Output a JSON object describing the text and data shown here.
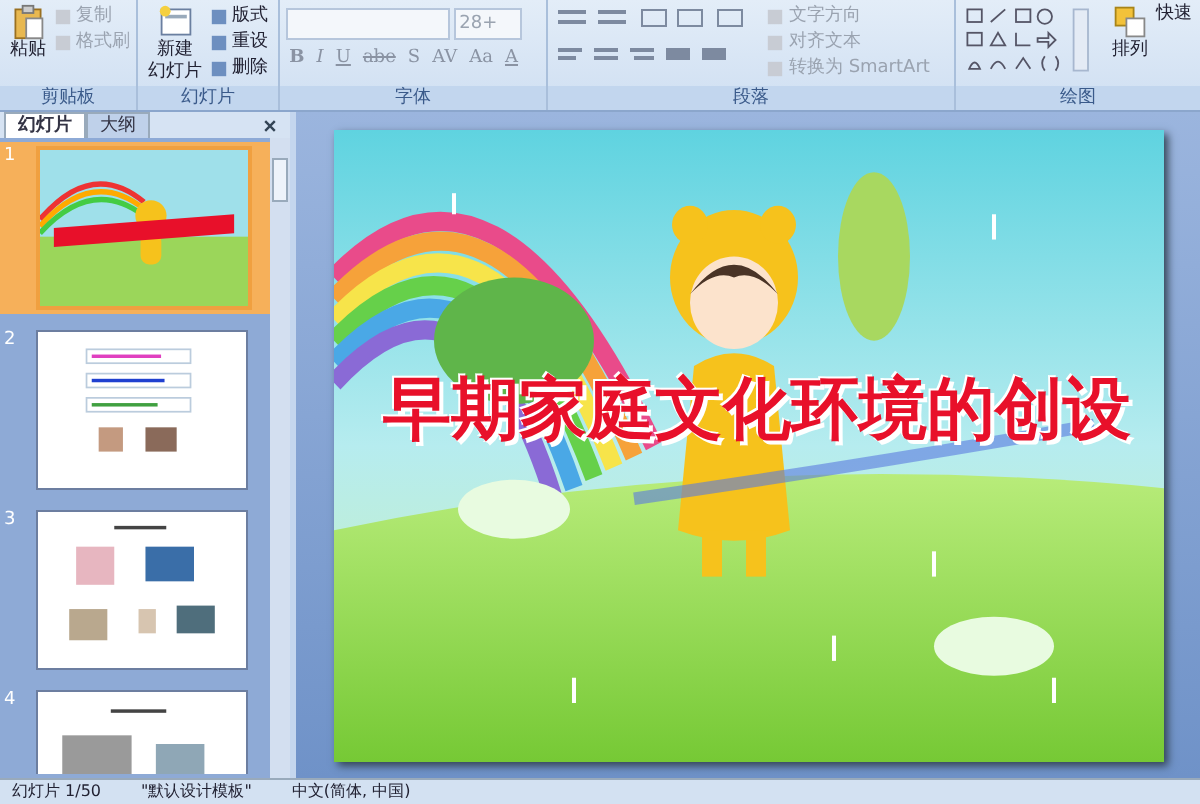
{
  "ribbon": {
    "groups": [
      {
        "label": "剪贴板",
        "kind": "clipboard",
        "big": [
          "粘贴"
        ],
        "small": [
          {
            "label": "复制",
            "disabled": true
          },
          {
            "label": "格式刷",
            "disabled": true
          }
        ]
      },
      {
        "label": "幻灯片",
        "kind": "slides",
        "big": [
          [
            "新建",
            "幻灯片"
          ]
        ],
        "small": [
          {
            "label": "版式",
            "disabled": false
          },
          {
            "label": "重设",
            "disabled": false
          },
          {
            "label": "删除",
            "disabled": false
          }
        ]
      },
      {
        "label": "字体",
        "kind": "font",
        "font_size": "28+",
        "format": [
          "B",
          "I",
          "U",
          "abe",
          "S",
          "AV",
          "Aa",
          "A"
        ]
      },
      {
        "label": "段落",
        "kind": "paragraph",
        "small": [
          {
            "label": "文字方向",
            "disabled": true
          },
          {
            "label": "对齐文本",
            "disabled": true
          },
          {
            "label": "转换为 SmartArt",
            "disabled": true
          }
        ]
      },
      {
        "label": "绘图",
        "kind": "drawing",
        "big": [
          "排列",
          "快速"
        ]
      }
    ]
  },
  "panel": {
    "tabs": [
      {
        "label": "幻灯片",
        "selected": true
      },
      {
        "label": "大纲",
        "selected": false
      }
    ],
    "slides": [
      {
        "number": "1",
        "selected": true,
        "kind": "title"
      },
      {
        "number": "2",
        "selected": false,
        "kind": "text-boxes"
      },
      {
        "number": "3",
        "selected": false,
        "kind": "photo-grid"
      },
      {
        "number": "4",
        "selected": false,
        "kind": "photo-pair"
      }
    ]
  },
  "slide": {
    "title": "早期家庭文化环境的创设"
  },
  "status_bar": [
    "幻灯片 1/50",
    "\"默认设计模板\"",
    "中文(简体, 中国)"
  ]
}
